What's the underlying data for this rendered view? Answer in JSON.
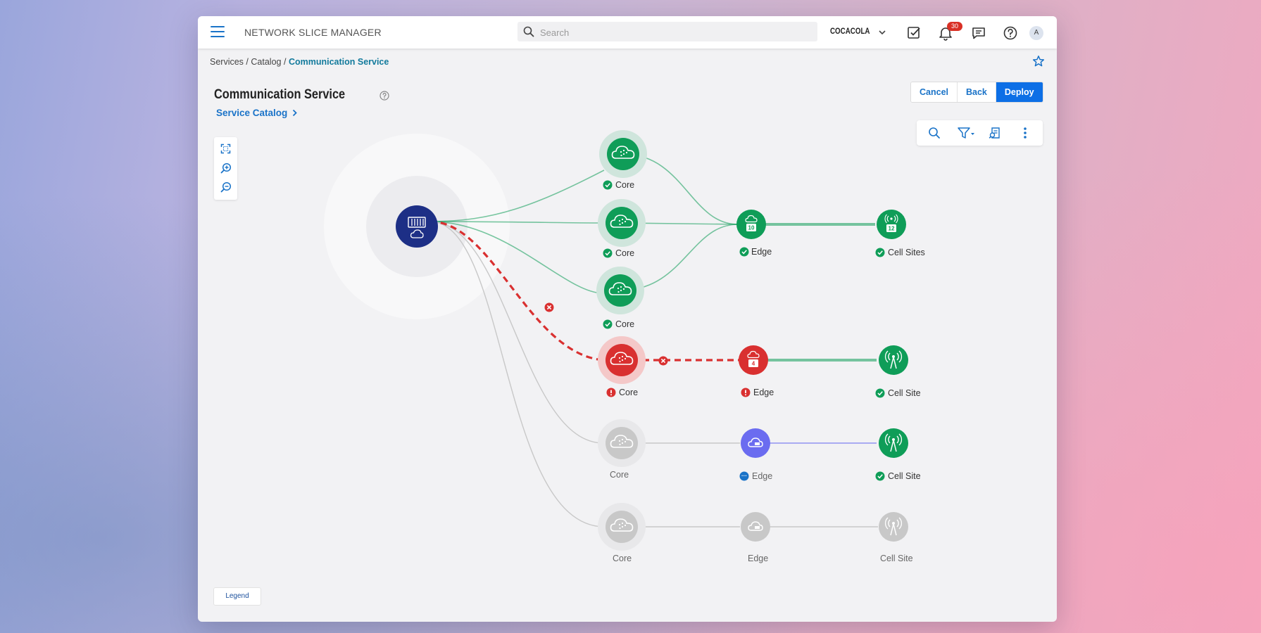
{
  "app": {
    "title": "NETWORK SLICE MANAGER",
    "search_placeholder": "Search",
    "org": "COCACOLA",
    "notification_count": "30",
    "avatar_initial": "A"
  },
  "breadcrumb": {
    "items": [
      "Services",
      "Catalog"
    ],
    "current": "Communication Service",
    "separator": "/"
  },
  "page": {
    "title": "Communication Service",
    "catalog_link": "Service Catalog"
  },
  "actions": {
    "cancel": "Cancel",
    "back": "Back",
    "deploy": "Deploy"
  },
  "legend": "Legend",
  "colors": {
    "green": "#0f9d58",
    "green_halo": "#cfe5dc",
    "red": "#d93030",
    "red_halo": "#f4c8c8",
    "gray": "#c8c8c8",
    "gray_halo": "#e8e8ea",
    "blue_root": "#1d2f86",
    "purple": "#6b6cf0",
    "accent": "#0d6fe6"
  },
  "topology": {
    "cores": [
      {
        "label": "Core",
        "status": "ok"
      },
      {
        "label": "Core",
        "status": "ok"
      },
      {
        "label": "Core",
        "status": "ok"
      },
      {
        "label": "Core",
        "status": "error"
      },
      {
        "label": "Core",
        "status": "inactive"
      },
      {
        "label": "Core",
        "status": "inactive"
      }
    ],
    "edges": [
      {
        "label": "Edge",
        "status": "ok",
        "count": "10"
      },
      {
        "label": "Edge",
        "status": "error",
        "count": "4"
      },
      {
        "label": "Edge",
        "status": "pending"
      },
      {
        "label": "Edge",
        "status": "inactive"
      }
    ],
    "cell_sites": [
      {
        "label": "Cell Sites",
        "status": "ok",
        "count": "12"
      },
      {
        "label": "Cell Site",
        "status": "ok"
      },
      {
        "label": "Cell Site",
        "status": "ok"
      },
      {
        "label": "Cell Site",
        "status": "inactive"
      }
    ]
  }
}
